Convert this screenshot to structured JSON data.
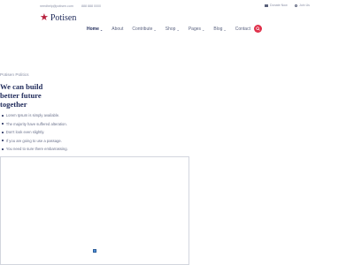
{
  "topbar": {
    "email": "needhelp@potisen.com",
    "phone": "888 888 0000",
    "donate": "Donate Now",
    "join": "Join Us"
  },
  "logo": {
    "name": "Potisen"
  },
  "nav": {
    "items": [
      {
        "label": "Home",
        "dropdown": true
      },
      {
        "label": "About",
        "dropdown": false
      },
      {
        "label": "Contribute",
        "dropdown": true
      },
      {
        "label": "Shop",
        "dropdown": true
      },
      {
        "label": "Pages",
        "dropdown": true
      },
      {
        "label": "Blog",
        "dropdown": true
      },
      {
        "label": "Contact",
        "dropdown": false
      }
    ]
  },
  "hero": {
    "eyebrow": "Potisen Politics",
    "headline": "We can build better future together",
    "bullets": [
      "Lorem Ipsum is simply available.",
      "The majority have suffered alteration.",
      "Don't look even slightly.",
      "If you are going to use a passage.",
      "You need to sure there embarrassing."
    ]
  },
  "colors": {
    "accent": "#e0314b",
    "brand": "#1f2a5a",
    "star": "#b7213d"
  },
  "icons": {
    "search": "search-icon",
    "donate": "card-icon",
    "join": "user-icon"
  }
}
